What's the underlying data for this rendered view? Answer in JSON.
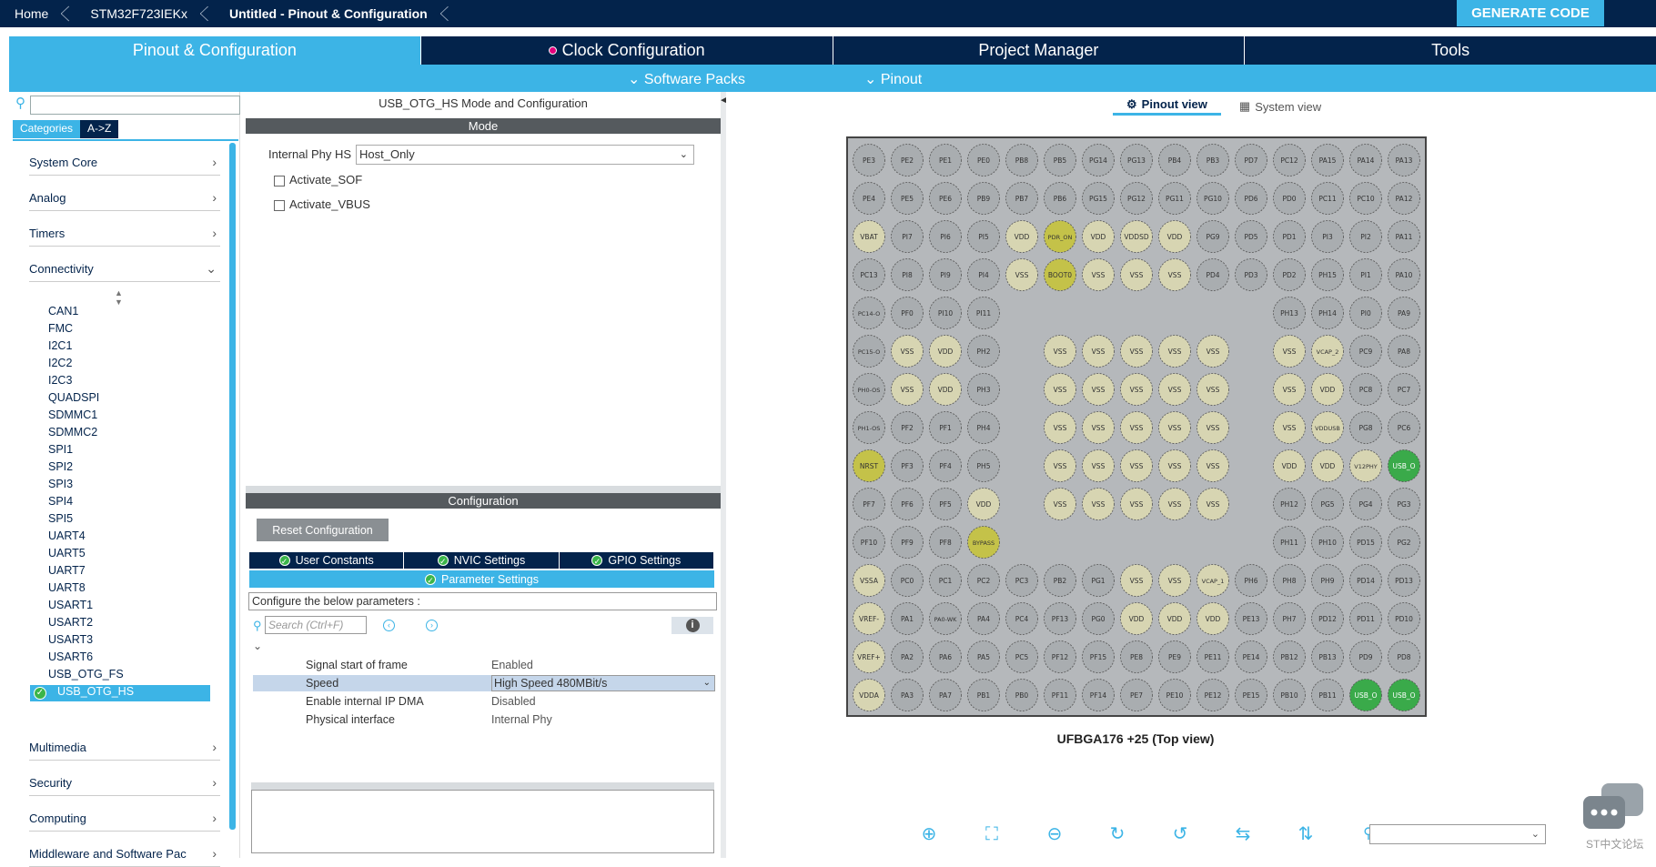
{
  "breadcrumbs": [
    "Home",
    "STM32F723IEKx",
    "Untitled - Pinout & Configuration"
  ],
  "generate_button": "GENERATE CODE",
  "main_tabs": [
    "Pinout & Configuration",
    "Clock Configuration",
    "Project Manager",
    "Tools"
  ],
  "sub_menu": [
    "Software Packs",
    "Pinout"
  ],
  "left_panel": {
    "search_placeholder": "",
    "category_buttons": [
      "Categories",
      "A->Z"
    ],
    "categories": [
      "System Core",
      "Analog",
      "Timers",
      "Connectivity",
      "Multimedia",
      "Security",
      "Computing",
      "Middleware and Software Pac"
    ],
    "connectivity_items": [
      "CAN1",
      "FMC",
      "I2C1",
      "I2C2",
      "I2C3",
      "QUADSPI",
      "SDMMC1",
      "SDMMC2",
      "SPI1",
      "SPI2",
      "SPI3",
      "SPI4",
      "SPI5",
      "UART4",
      "UART5",
      "UART7",
      "UART8",
      "USART1",
      "USART2",
      "USART3",
      "USART6",
      "USB_OTG_FS",
      "USB_OTG_HS"
    ],
    "selected_item": "USB_OTG_HS"
  },
  "mode_panel": {
    "title": "USB_OTG_HS Mode and Configuration",
    "mode_header": "Mode",
    "internal_phy_label": "Internal Phy HS",
    "internal_phy_value": "Host_Only",
    "checkboxes": [
      "Activate_SOF",
      "Activate_VBUS"
    ],
    "config_header": "Configuration",
    "reset_button": "Reset Configuration",
    "config_tabs": [
      "User Constants",
      "NVIC Settings",
      "GPIO Settings"
    ],
    "parameter_tab": "Parameter Settings",
    "configure_text": "Configure the below parameters :",
    "search_placeholder": "Search (Ctrl+F)",
    "parameters": [
      {
        "name": "Signal start of frame",
        "value": "Enabled"
      },
      {
        "name": "Speed",
        "value": "High Speed 480MBit/s"
      },
      {
        "name": "Enable internal IP DMA",
        "value": "Disabled"
      },
      {
        "name": "Physical interface",
        "value": "Internal Phy"
      }
    ]
  },
  "pinout": {
    "view_tabs": [
      "Pinout view",
      "System view"
    ],
    "package_label": "UFBGA176 +25 (Top view)",
    "watermark": "ST中文论坛",
    "colors": {
      "io": "#a9adb0",
      "power": "#d7d5b2",
      "active": "#3aaa4a",
      "special": "#c4c249",
      "chip": "#b5b8bb"
    },
    "pin_rows": [
      [
        "PE3",
        "PE2",
        "PE1",
        "PE0",
        "PB8",
        "PB5",
        "PG14",
        "PG13",
        "PB4",
        "PB3",
        "PD7",
        "PC12",
        "PA15",
        "PA14",
        "PA13"
      ],
      [
        "PE4",
        "PE5",
        "PE6",
        "PB9",
        "PB7",
        "PB6",
        "PG15",
        "PG12",
        "PG11",
        "PG10",
        "PD6",
        "PD0",
        "PC11",
        "PC10",
        "PA12"
      ],
      [
        "VBAT",
        "PI7",
        "PI6",
        "PI5",
        "VDD",
        "PDR_ON",
        "VDD",
        "VDDSD",
        "VDD",
        "PG9",
        "PD5",
        "PD1",
        "PI3",
        "PI2",
        "PA11"
      ],
      [
        "PC13",
        "PI8",
        "PI9",
        "PI4",
        "VSS",
        "BOOT0",
        "VSS",
        "VSS",
        "VSS",
        "PD4",
        "PD3",
        "PD2",
        "PH15",
        "PI1",
        "PA10"
      ],
      [
        "PC14-O",
        "PF0",
        "PI10",
        "PI11",
        "",
        "",
        "",
        "",
        "",
        "",
        "",
        "PH13",
        "PH14",
        "PI0",
        "PA9"
      ],
      [
        "PC15-O",
        "VSS",
        "VDD",
        "PH2",
        "",
        "VSS",
        "VSS",
        "VSS",
        "VSS",
        "VSS",
        "",
        "VSS",
        "VCAP_2",
        "PC9",
        "PA8"
      ],
      [
        "PH0-OS",
        "VSS",
        "VDD",
        "PH3",
        "",
        "VSS",
        "VSS",
        "VSS",
        "VSS",
        "VSS",
        "",
        "VSS",
        "VDD",
        "PC8",
        "PC7"
      ],
      [
        "PH1-OS",
        "PF2",
        "PF1",
        "PH4",
        "",
        "VSS",
        "VSS",
        "VSS",
        "VSS",
        "VSS",
        "",
        "VSS",
        "VDDUSB",
        "PG8",
        "PC6"
      ],
      [
        "NRST",
        "PF3",
        "PF4",
        "PH5",
        "",
        "VSS",
        "VSS",
        "VSS",
        "VSS",
        "VSS",
        "",
        "VDD",
        "VDD",
        "V12PHY",
        "USB_O"
      ],
      [
        "PF7",
        "PF6",
        "PF5",
        "VDD",
        "",
        "VSS",
        "VSS",
        "VSS",
        "VSS",
        "VSS",
        "",
        "PH12",
        "PG5",
        "PG4",
        "PG3"
      ],
      [
        "PF10",
        "PF9",
        "PF8",
        "BYPASS",
        "",
        "",
        "",
        "",
        "",
        "",
        "",
        "PH11",
        "PH10",
        "PD15",
        "PG2"
      ],
      [
        "VSSA",
        "PC0",
        "PC1",
        "PC2",
        "PC3",
        "PB2",
        "PG1",
        "VSS",
        "VSS",
        "VCAP_1",
        "PH6",
        "PH8",
        "PH9",
        "PD14",
        "PD13"
      ],
      [
        "VREF-",
        "PA1",
        "PA0-WK",
        "PA4",
        "PC4",
        "PF13",
        "PG0",
        "VDD",
        "VDD",
        "VDD",
        "PE13",
        "PH7",
        "PD12",
        "PD11",
        "PD10"
      ],
      [
        "VREF+",
        "PA2",
        "PA6",
        "PA5",
        "PC5",
        "PF12",
        "PF15",
        "PE8",
        "PE9",
        "PE11",
        "PE14",
        "PB12",
        "PB13",
        "PD9",
        "PD8"
      ],
      [
        "VDDA",
        "PA3",
        "PA7",
        "PB1",
        "PB0",
        "PF11",
        "PF14",
        "PE7",
        "PE10",
        "PE12",
        "PE15",
        "PB10",
        "PB11",
        "USB_O",
        "USB_O"
      ]
    ],
    "active_pins": [
      "USB_O"
    ],
    "special_pins": [
      "PDR_ON",
      "BOOT0",
      "NRST",
      "BYPASS"
    ]
  }
}
